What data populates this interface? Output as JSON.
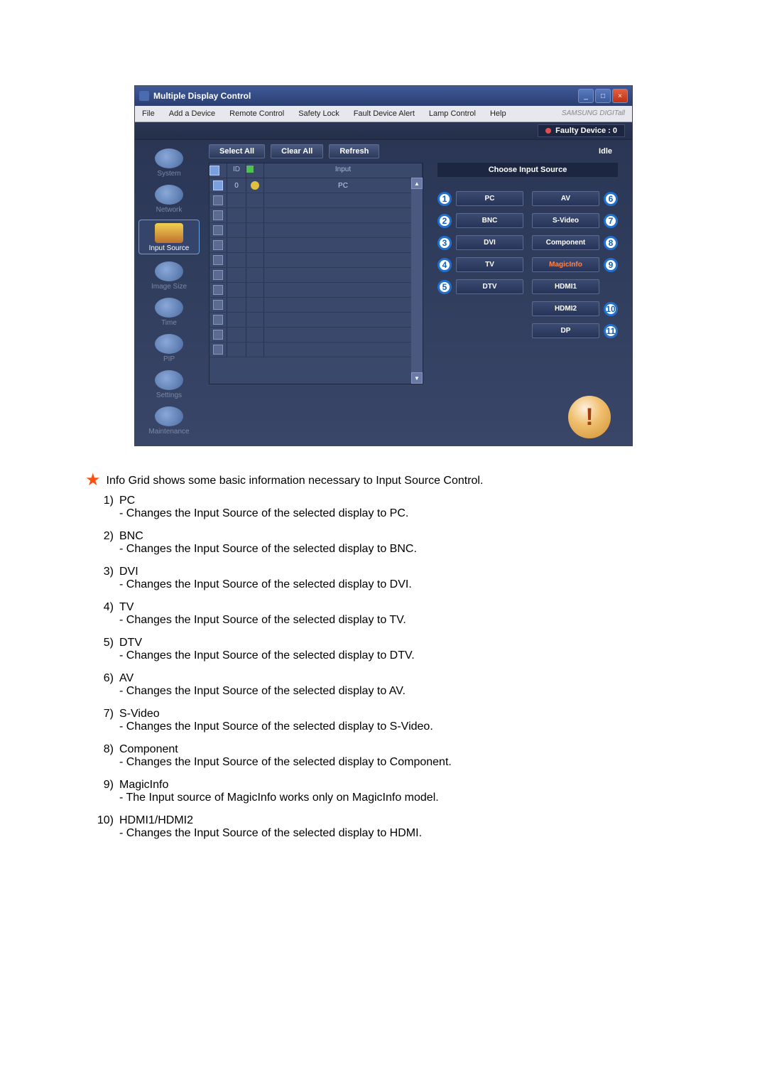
{
  "window": {
    "title": "Multiple Display Control"
  },
  "menu": {
    "file": "File",
    "add": "Add a Device",
    "remote": "Remote Control",
    "safety": "Safety Lock",
    "fault": "Fault Device Alert",
    "lamp": "Lamp Control",
    "help": "Help",
    "brand": "SAMSUNG DIGITall"
  },
  "status": {
    "faulty": "Faulty Device : 0"
  },
  "toolbar": {
    "select_all": "Select All",
    "clear_all": "Clear All",
    "refresh": "Refresh",
    "idle": "Idle"
  },
  "sidebar": {
    "system": "System",
    "network": "Network",
    "input": "Input Source",
    "image": "Image Size",
    "time": "Time",
    "pip": "PIP",
    "settings": "Settings",
    "maintenance": "Maintenance"
  },
  "grid": {
    "header_id": "ID",
    "header_input": "Input",
    "row0_id": "0",
    "row0_input": "PC"
  },
  "right": {
    "choose": "Choose Input Source",
    "sources": {
      "n1": "1",
      "pc": "PC",
      "n2": "2",
      "bnc": "BNC",
      "n3": "3",
      "dvi": "DVI",
      "n4": "4",
      "tv": "TV",
      "n5": "5",
      "dtv": "DTV",
      "n6": "6",
      "av": "AV",
      "n7": "7",
      "svideo": "S-Video",
      "n8": "8",
      "component": "Component",
      "n9": "9",
      "magic": "MagicInfo",
      "n10": "10",
      "hdmi1": "HDMI1",
      "hdmi2": "HDMI2",
      "n11": "11",
      "dp": "DP"
    },
    "bang": "!"
  },
  "doc": {
    "info": "Info Grid shows some basic information necessary to Input Source Control.",
    "items": [
      {
        "num": "1)",
        "title": "PC",
        "desc": "- Changes the Input Source of the selected display to PC."
      },
      {
        "num": "2)",
        "title": "BNC",
        "desc": "- Changes the Input Source of the selected display to BNC."
      },
      {
        "num": "3)",
        "title": "DVI",
        "desc": "- Changes the Input Source of the selected display to DVI."
      },
      {
        "num": "4)",
        "title": "TV",
        "desc": "- Changes the Input Source of the selected display to TV."
      },
      {
        "num": "5)",
        "title": "DTV",
        "desc": "- Changes the Input Source of the selected display to DTV."
      },
      {
        "num": "6)",
        "title": "AV",
        "desc": "- Changes the Input Source of the selected display to AV."
      },
      {
        "num": "7)",
        "title": "S-Video",
        "desc": "- Changes the Input Source of the selected display to S-Video."
      },
      {
        "num": "8)",
        "title": "Component",
        "desc": "- Changes the Input Source of the selected display to Component."
      },
      {
        "num": "9)",
        "title": "MagicInfo",
        "desc": "- The Input source of MagicInfo works only on MagicInfo model."
      },
      {
        "num": "10)",
        "title": "HDMI1/HDMI2",
        "desc": "- Changes the Input Source of the selected display to HDMI."
      }
    ]
  }
}
